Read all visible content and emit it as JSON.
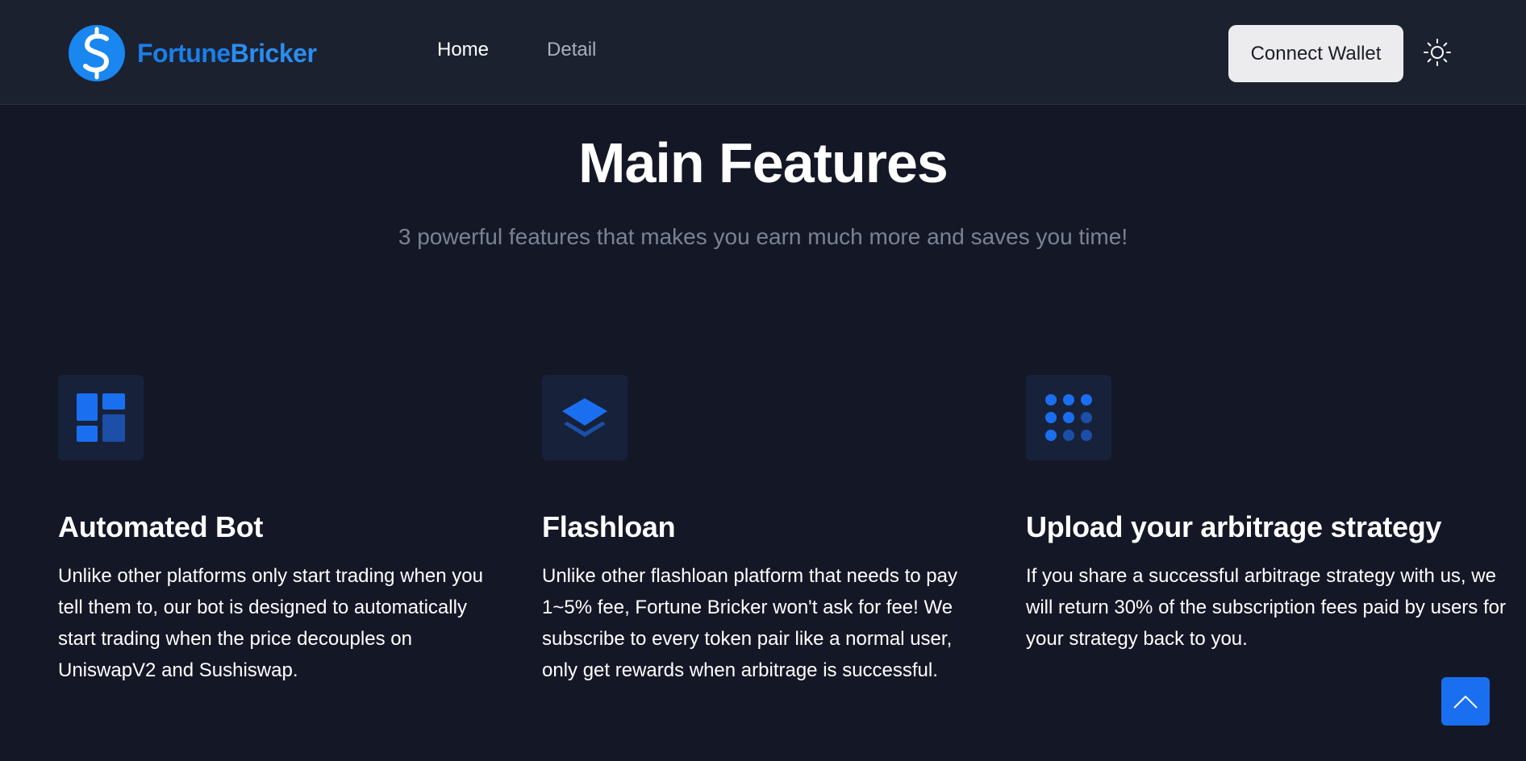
{
  "header": {
    "brand": {
      "part1": "Fortune",
      "part2": "Bricker"
    },
    "nav": [
      {
        "label": "Home",
        "active": true
      },
      {
        "label": "Detail",
        "active": false
      }
    ],
    "connect_wallet_label": "Connect Wallet",
    "theme_icon": "sun-icon"
  },
  "main": {
    "title": "Main Features",
    "subtitle": "3 powerful features that makes you earn much more and saves you time!",
    "features": [
      {
        "icon": "dashboard-icon",
        "title": "Automated Bot",
        "description": "Unlike other platforms only start trading when you tell them to, our bot is designed to automatically start trading when the price decouples on UniswapV2 and Sushiswap."
      },
      {
        "icon": "layers-icon",
        "title": "Flashloan",
        "description": "Unlike other flashloan platform that needs to pay 1~5% fee, Fortune Bricker won't ask for fee! We subscribe to every token pair like a normal user, only get rewards when arbitrage is successful."
      },
      {
        "icon": "dots-grid-icon",
        "title": "Upload your arbitrage strategy",
        "description": "If you share a successful arbitrage strategy with us, we will return 30% of the subscription fees paid by users for your strategy back to you."
      }
    ]
  },
  "scroll_top_icon": "chevron-up-icon",
  "colors": {
    "background": "#141826",
    "navbar": "#1c2130",
    "accent": "#1a6ff0",
    "brand": "#1a7fe6",
    "muted_text": "#7b8294"
  }
}
